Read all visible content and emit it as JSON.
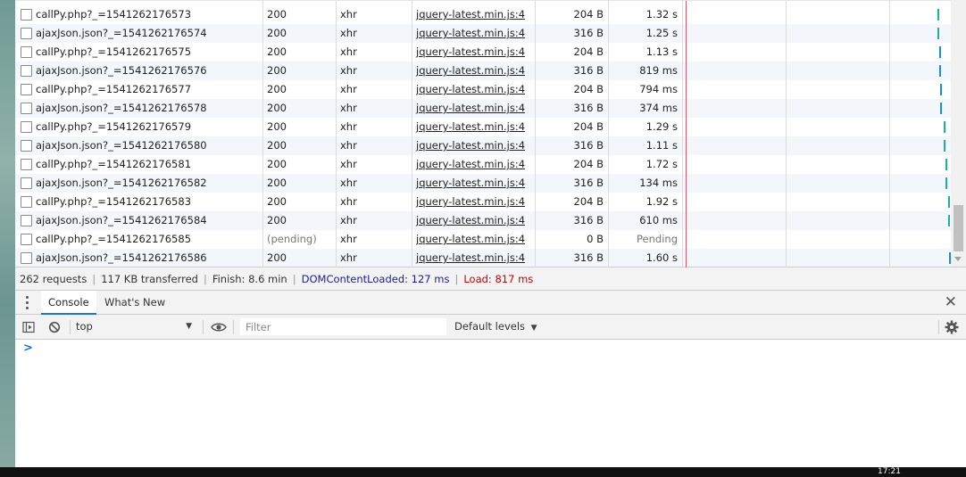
{
  "network": {
    "rows": [
      {
        "name": "callPy.php?_=1541262176573",
        "status": "200",
        "type": "xhr",
        "initiator": "jquery-latest.min.js:4",
        "size": "204 B",
        "time": "1.32 s",
        "bar_color": "#18b39a",
        "pending": false
      },
      {
        "name": "ajaxJson.json?_=1541262176574",
        "status": "200",
        "type": "xhr",
        "initiator": "jquery-latest.min.js:4",
        "size": "316 B",
        "time": "1.25 s",
        "bar_color": "#18b39a",
        "pending": false
      },
      {
        "name": "callPy.php?_=1541262176575",
        "status": "200",
        "type": "xhr",
        "initiator": "jquery-latest.min.js:4",
        "size": "204 B",
        "time": "1.13 s",
        "bar_color": "#1a8fd8",
        "pending": false
      },
      {
        "name": "ajaxJson.json?_=1541262176576",
        "status": "200",
        "type": "xhr",
        "initiator": "jquery-latest.min.js:4",
        "size": "316 B",
        "time": "819 ms",
        "bar_color": "#1a8fd8",
        "pending": false
      },
      {
        "name": "callPy.php?_=1541262176577",
        "status": "200",
        "type": "xhr",
        "initiator": "jquery-latest.min.js:4",
        "size": "204 B",
        "time": "794 ms",
        "bar_color": "#1a8fd8",
        "pending": false
      },
      {
        "name": "ajaxJson.json?_=1541262176578",
        "status": "200",
        "type": "xhr",
        "initiator": "jquery-latest.min.js:4",
        "size": "316 B",
        "time": "374 ms",
        "bar_color": "#1a8fd8",
        "pending": false
      },
      {
        "name": "callPy.php?_=1541262176579",
        "status": "200",
        "type": "xhr",
        "initiator": "jquery-latest.min.js:4",
        "size": "204 B",
        "time": "1.29 s",
        "bar_color": "#18b39a",
        "pending": false
      },
      {
        "name": "ajaxJson.json?_=1541262176580",
        "status": "200",
        "type": "xhr",
        "initiator": "jquery-latest.min.js:4",
        "size": "316 B",
        "time": "1.11 s",
        "bar_color": "#18b39a",
        "pending": false
      },
      {
        "name": "callPy.php?_=1541262176581",
        "status": "200",
        "type": "xhr",
        "initiator": "jquery-latest.min.js:4",
        "size": "204 B",
        "time": "1.72 s",
        "bar_color": "#18b39a",
        "pending": false
      },
      {
        "name": "ajaxJson.json?_=1541262176582",
        "status": "200",
        "type": "xhr",
        "initiator": "jquery-latest.min.js:4",
        "size": "316 B",
        "time": "134 ms",
        "bar_color": "#18b39a",
        "pending": false
      },
      {
        "name": "callPy.php?_=1541262176583",
        "status": "200",
        "type": "xhr",
        "initiator": "jquery-latest.min.js:4",
        "size": "204 B",
        "time": "1.92 s",
        "bar_color": "#18b39a",
        "pending": false
      },
      {
        "name": "ajaxJson.json?_=1541262176584",
        "status": "200",
        "type": "xhr",
        "initiator": "jquery-latest.min.js:4",
        "size": "316 B",
        "time": "610 ms",
        "bar_color": "#18b39a",
        "pending": false
      },
      {
        "name": "callPy.php?_=1541262176585",
        "status": "(pending)",
        "type": "xhr",
        "initiator": "jquery-latest.min.js:4",
        "size": "0 B",
        "time": "Pending",
        "bar_color": "",
        "pending": true
      },
      {
        "name": "ajaxJson.json?_=1541262176586",
        "status": "200",
        "type": "xhr",
        "initiator": "jquery-latest.min.js:4",
        "size": "316 B",
        "time": "1.60 s",
        "bar_color": "#1a8fd8",
        "pending": false
      }
    ]
  },
  "summary": {
    "requests": "262 requests",
    "transferred": "117 KB transferred",
    "finish": "Finish: 8.6 min",
    "dom_content_loaded": "DOMContentLoaded: 127 ms",
    "load": "Load: 817 ms",
    "dcl_color": "#1a1aa6",
    "load_color": "#c80000"
  },
  "drawer": {
    "tabs": [
      "Console",
      "What's New"
    ],
    "active_tab": "Console",
    "close_icon": "close-icon"
  },
  "console_toolbar": {
    "context": "top",
    "filter_placeholder": "Filter",
    "levels": "Default levels"
  },
  "console": {
    "prompt": ">"
  },
  "taskbar": {
    "clock": "17:21"
  }
}
